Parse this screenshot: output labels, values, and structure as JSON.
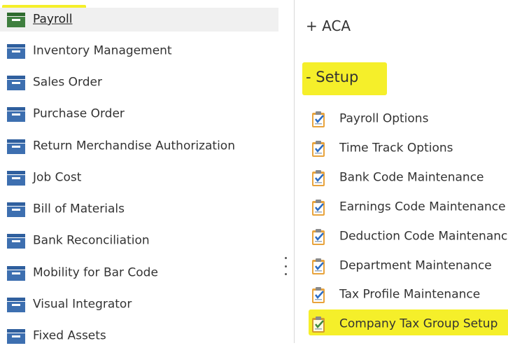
{
  "modules": [
    {
      "label": "Payroll",
      "selected": true
    },
    {
      "label": "Inventory Management"
    },
    {
      "label": "Sales Order"
    },
    {
      "label": "Purchase Order"
    },
    {
      "label": "Return Merchandise Authorization"
    },
    {
      "label": "Job Cost"
    },
    {
      "label": "Bill of Materials"
    },
    {
      "label": "Bank Reconciliation"
    },
    {
      "label": "Mobility for Bar Code"
    },
    {
      "label": "Visual Integrator"
    },
    {
      "label": "Fixed Assets"
    }
  ],
  "groups": {
    "aca": {
      "label": "+ ACA"
    },
    "setup": {
      "label": "-  Setup"
    }
  },
  "setup_tasks": [
    {
      "label": "Payroll Options"
    },
    {
      "label": "Time Track Options"
    },
    {
      "label": "Bank Code Maintenance"
    },
    {
      "label": "Earnings Code Maintenance"
    },
    {
      "label": "Deduction Code Maintenance"
    },
    {
      "label": "Department Maintenance"
    },
    {
      "label": "Tax Profile Maintenance"
    },
    {
      "label": "Company Tax Group Setup"
    }
  ],
  "colors": {
    "highlight": "#f5ef2a",
    "module_icon": "#3d6fb0",
    "selected_module_icon": "#3f7f3f"
  }
}
